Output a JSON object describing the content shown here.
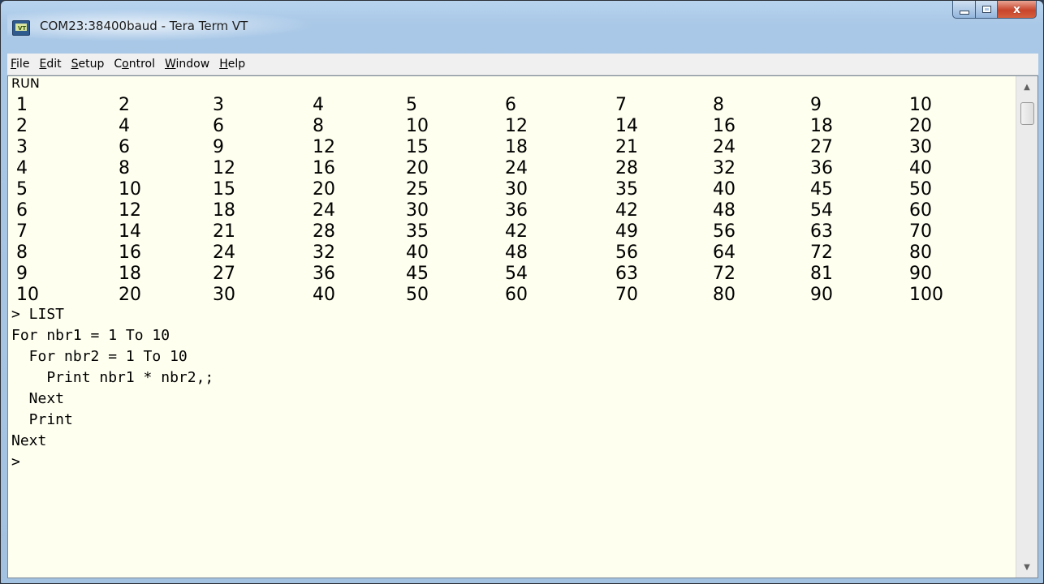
{
  "window": {
    "title": "COM23:38400baud - Tera Term VT",
    "app_icon_text": "VT"
  },
  "caption": {
    "close_glyph": "x"
  },
  "menu": [
    {
      "pre": "",
      "acc": "F",
      "post": "ile"
    },
    {
      "pre": "",
      "acc": "E",
      "post": "dit"
    },
    {
      "pre": "",
      "acc": "S",
      "post": "etup"
    },
    {
      "pre": "C",
      "acc": "o",
      "post": "ntrol"
    },
    {
      "pre": "",
      "acc": "W",
      "post": "indow"
    },
    {
      "pre": "",
      "acc": "H",
      "post": "elp"
    }
  ],
  "terminal": {
    "run_line": "RUN",
    "table": [
      [
        "1",
        "2",
        "3",
        "4",
        "5",
        "6",
        "7",
        "8",
        "9",
        "10"
      ],
      [
        "2",
        "4",
        "6",
        "8",
        "10",
        "12",
        "14",
        "16",
        "18",
        "20"
      ],
      [
        "3",
        "6",
        "9",
        "12",
        "15",
        "18",
        "21",
        "24",
        "27",
        "30"
      ],
      [
        "4",
        "8",
        "12",
        "16",
        "20",
        "24",
        "28",
        "32",
        "36",
        "40"
      ],
      [
        "5",
        "10",
        "15",
        "20",
        "25",
        "30",
        "35",
        "40",
        "45",
        "50"
      ],
      [
        "6",
        "12",
        "18",
        "24",
        "30",
        "36",
        "42",
        "48",
        "54",
        "60"
      ],
      [
        "7",
        "14",
        "21",
        "28",
        "35",
        "42",
        "49",
        "56",
        "63",
        "70"
      ],
      [
        "8",
        "16",
        "24",
        "32",
        "40",
        "48",
        "56",
        "64",
        "72",
        "80"
      ],
      [
        "9",
        "18",
        "27",
        "36",
        "45",
        "54",
        "63",
        "72",
        "81",
        "90"
      ],
      [
        "10",
        "20",
        "30",
        "40",
        "50",
        "60",
        "70",
        "80",
        "90",
        "100"
      ]
    ],
    "listing": [
      "> LIST",
      "For nbr1 = 1 To 10",
      "  For nbr2 = 1 To 10",
      "    Print nbr1 * nbr2,;",
      "  Next",
      "  Print",
      "Next",
      ">"
    ]
  },
  "scrollbar": {
    "up_glyph": "▲",
    "down_glyph": "▼"
  }
}
